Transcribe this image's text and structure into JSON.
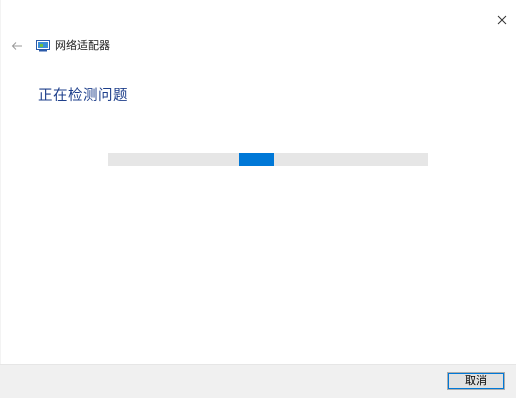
{
  "window": {
    "title": "网络适配器",
    "icons": {
      "close": "close-icon",
      "back": "back-arrow-icon",
      "app": "network-adapter-icon"
    }
  },
  "main": {
    "heading": "正在检测问题",
    "progress": {
      "state": "indeterminate",
      "chunk_start_fraction": 0.41,
      "chunk_width_fraction": 0.11
    }
  },
  "footer": {
    "cancel_label": "取消"
  },
  "colors": {
    "heading": "#1e3f8b",
    "accent": "#0078d7",
    "track": "#e6e6e6",
    "footer_bg": "#f0f0f0"
  }
}
